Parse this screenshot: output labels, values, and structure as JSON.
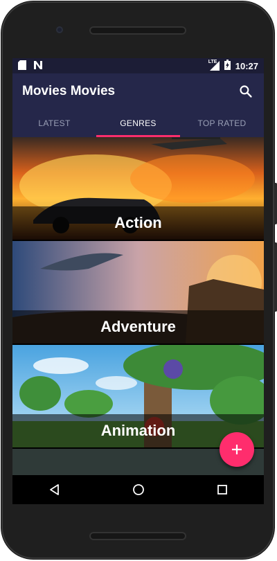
{
  "status": {
    "time": "10:27",
    "lte": "LTE"
  },
  "app": {
    "title": "Movies Movies"
  },
  "tabs": [
    {
      "label": "LATEST"
    },
    {
      "label": "GENRES"
    },
    {
      "label": "TOP RATED"
    }
  ],
  "genres": [
    {
      "label": "Action"
    },
    {
      "label": "Adventure"
    },
    {
      "label": "Animation"
    }
  ],
  "colors": {
    "primary": "#25274a",
    "status": "#1c1d36",
    "accent": "#ff2d6d"
  },
  "icons": [
    "sd-card-icon",
    "n-notification-icon",
    "signal-icon",
    "battery-icon",
    "search-icon",
    "add-icon",
    "back-icon",
    "home-icon",
    "recents-icon"
  ]
}
